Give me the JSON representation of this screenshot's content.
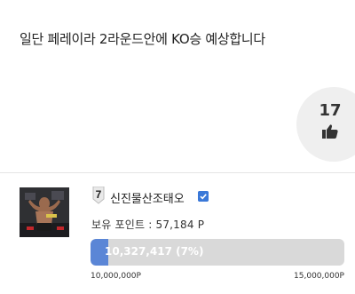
{
  "post": {
    "text": "일단 페레이라 2라운드안에 KO승 예상합니다",
    "likes": "17",
    "like_icon": "thumbs-up-icon"
  },
  "profile": {
    "level": "7",
    "username": "신진물산조태오",
    "verified_icon": "check-badge-icon",
    "points_text": "보유 포인트 : 57,184 P",
    "progress": {
      "label": "10,327,417 (7%)",
      "percent": 7,
      "min_label": "10,000,000P",
      "max_label": "15,000,000P"
    }
  },
  "colors": {
    "progress_fill": "#5b86d6",
    "progress_track": "#d9d9d9",
    "verified": "#3a78d8",
    "like_bg": "#efefef"
  }
}
